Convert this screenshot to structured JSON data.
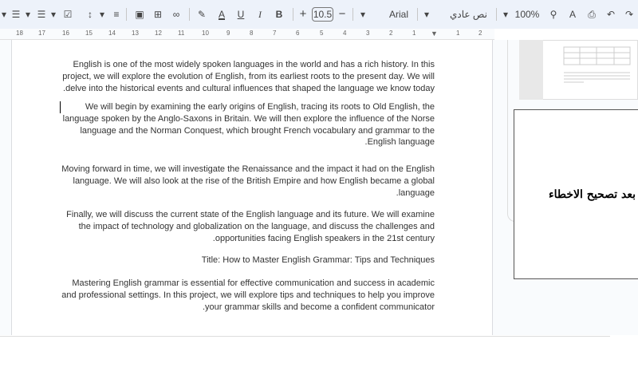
{
  "toolbar": {
    "font_size": "10.5",
    "font_name": "Arial",
    "style": "نص عادي",
    "zoom": "100%",
    "icons": [
      "checklist-icon",
      "numbered-list-icon",
      "bulleted-list-icon",
      "checklist-icon",
      "line-spacing-icon",
      "align-right-icon",
      "image-icon",
      "comment-icon",
      "link-icon",
      "highlight-icon",
      "text-color-icon",
      "underline-icon",
      "italic-icon",
      "bold-icon",
      "increase-font-icon",
      "decrease-font-icon",
      "paint-format-icon",
      "spellcheck-icon",
      "print-icon",
      "undo-icon",
      "redo-icon"
    ]
  },
  "ruler": {
    "ticks": [
      "18",
      "17",
      "16",
      "15",
      "14",
      "13",
      "12",
      "11",
      "10",
      "9",
      "8",
      "7",
      "6",
      "5",
      "4",
      "3",
      "2",
      "1",
      "1",
      "2"
    ]
  },
  "document": {
    "paragraphs": [
      [
        "English is one of the most widely spoken languages in the world and has a rich history. In this",
        "project, we will explore the evolution of English, from its earliest roots to the present day. We will",
        ".delve into the historical events and cultural influences that shaped the language we know today"
      ],
      [
        "We will begin by examining the early origins of English, tracing its roots to Old English, the",
        "language spoken by the Anglo-Saxons in Britain. We will then explore the influence of the Norse",
        "language and the Norman Conquest, which brought French vocabulary and grammar to the",
        ".English language"
      ],
      [
        "Moving forward in time, we will investigate the Renaissance and the impact it had on the English",
        "language. We will also look at the rise of the British Empire and how English became a global",
        ".language"
      ],
      [
        "Finally, we will discuss the current state of the English language and its future. We will examine",
        "the impact of technology and globalization on the language, and discuss the challenges and",
        ".opportunities facing English speakers in the 21st century"
      ],
      [
        "Title: How to Master English Grammar: Tips and Techniques"
      ],
      [
        "Mastering English grammar is essential for effective communication and success in academic",
        "and professional settings. In this project, we will explore tips and techniques to help you improve",
        ".your grammar skills and become a confident communicator"
      ]
    ]
  },
  "annotation": {
    "text": "بعد تصحيح الاخطاء"
  }
}
